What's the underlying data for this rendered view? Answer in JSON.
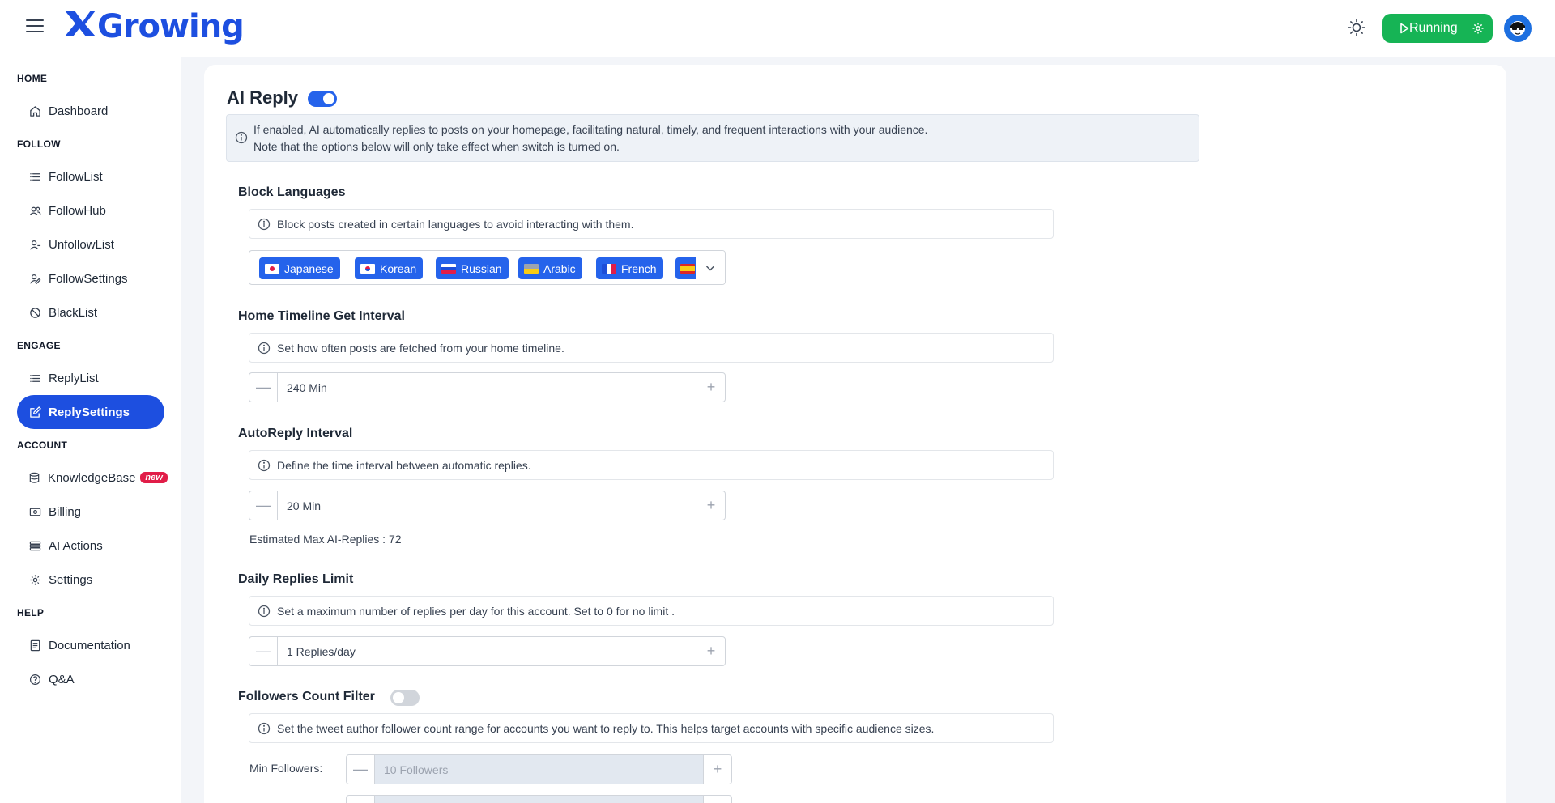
{
  "header": {
    "brand": "Growing",
    "running_label": "Running"
  },
  "sidebar": {
    "sections": [
      {
        "title": "HOME",
        "items": [
          {
            "label": "Dashboard",
            "icon": "home-icon"
          }
        ]
      },
      {
        "title": "FOLLOW",
        "items": [
          {
            "label": "FollowList",
            "icon": "list-icon"
          },
          {
            "label": "FollowHub",
            "icon": "users-icon"
          },
          {
            "label": "UnfollowList",
            "icon": "user-minus-icon"
          },
          {
            "label": "FollowSettings",
            "icon": "user-settings-icon"
          },
          {
            "label": "BlackList",
            "icon": "ban-icon"
          }
        ]
      },
      {
        "title": "ENGAGE",
        "items": [
          {
            "label": "ReplyList",
            "icon": "list-icon"
          },
          {
            "label": "ReplySettings",
            "icon": "edit-icon",
            "active": true
          }
        ]
      },
      {
        "title": "ACCOUNT",
        "items": [
          {
            "label": "KnowledgeBase",
            "icon": "database-icon",
            "badge": "new"
          },
          {
            "label": "Billing",
            "icon": "money-icon"
          },
          {
            "label": "AI Actions",
            "icon": "stack-icon"
          },
          {
            "label": "Settings",
            "icon": "gear-icon"
          }
        ]
      },
      {
        "title": "HELP",
        "items": [
          {
            "label": "Documentation",
            "icon": "document-icon"
          },
          {
            "label": "Q&A",
            "icon": "question-icon"
          }
        ]
      }
    ]
  },
  "main": {
    "title": "AI Reply",
    "ai_reply_enabled": true,
    "info_line1": "If enabled, AI automatically replies to posts on your homepage, facilitating natural, timely, and frequent interactions with your audience.",
    "info_line2": "Note that the options below will only take effect when switch is turned on.",
    "block_languages": {
      "title": "Block Languages",
      "info": "Block posts created in certain languages to avoid interacting with them.",
      "tags": [
        "Japanese",
        "Korean",
        "Russian",
        "Arabic",
        "French"
      ]
    },
    "home_timeline": {
      "title": "Home Timeline Get Interval",
      "info": "Set how often posts are fetched from your home timeline.",
      "value": "240 Min"
    },
    "autoreply": {
      "title": "AutoReply Interval",
      "info": "Define the time interval between automatic replies.",
      "value": "20 Min",
      "estimated": "Estimated Max AI-Replies : 72"
    },
    "daily_limit": {
      "title": "Daily Replies Limit",
      "info": "Set a maximum number of replies per day for this account. Set to 0 for no limit .",
      "value": "1 Replies/day"
    },
    "followers_filter": {
      "title": "Followers Count Filter",
      "enabled": false,
      "info": "Set the tweet author follower count range for accounts you want to reply to. This helps target accounts with specific audience sizes.",
      "min_label": "Min Followers:",
      "min_value": "10 Followers"
    }
  },
  "colors": {
    "brand": "#1d4fe0",
    "running": "#16b455",
    "tag": "#2563eb"
  }
}
